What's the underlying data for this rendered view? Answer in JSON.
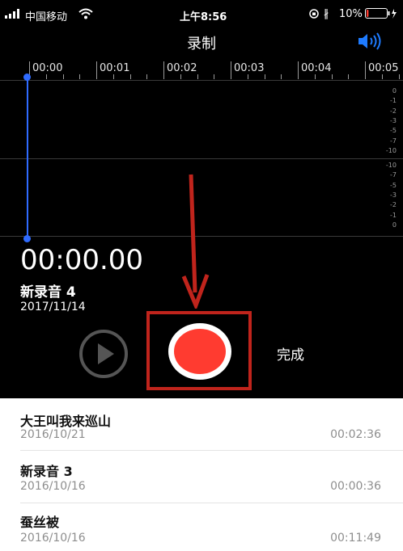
{
  "status_bar": {
    "carrier": "中国移动",
    "time": "上午8:56",
    "battery_percent": "10%",
    "battery_level": 0.1,
    "colors": {
      "battery_low": "#ff3b30"
    }
  },
  "header": {
    "title": "录制",
    "speaker_icon": "speaker-icon"
  },
  "timeline": {
    "ticks": [
      "00:00",
      "00:01",
      "00:02",
      "00:03",
      "00:04",
      "00:05"
    ],
    "scale_top": [
      "0",
      "-1",
      "-2",
      "-3",
      "-5",
      "-7",
      "-10"
    ],
    "scale_bottom": [
      "-10",
      "-7",
      "-5",
      "-3",
      "-2",
      "-1",
      "0"
    ],
    "playhead_color": "#2f6bff"
  },
  "recording": {
    "elapsed": "00:00.00",
    "name": "新录音 4",
    "date": "2017/11/14"
  },
  "controls": {
    "play_icon": "play-icon",
    "record_icon": "record-icon",
    "done_label": "完成",
    "record_color": "#ff3b30",
    "highlight_color": "#c0241c"
  },
  "recordings": [
    {
      "title": "大王叫我来巡山",
      "date": "2016/10/21",
      "duration": "00:02:36"
    },
    {
      "title": "新录音 3",
      "date": "2016/10/16",
      "duration": "00:00:36"
    },
    {
      "title": "蚕丝被",
      "date": "2016/10/16",
      "duration": "00:11:49"
    }
  ]
}
